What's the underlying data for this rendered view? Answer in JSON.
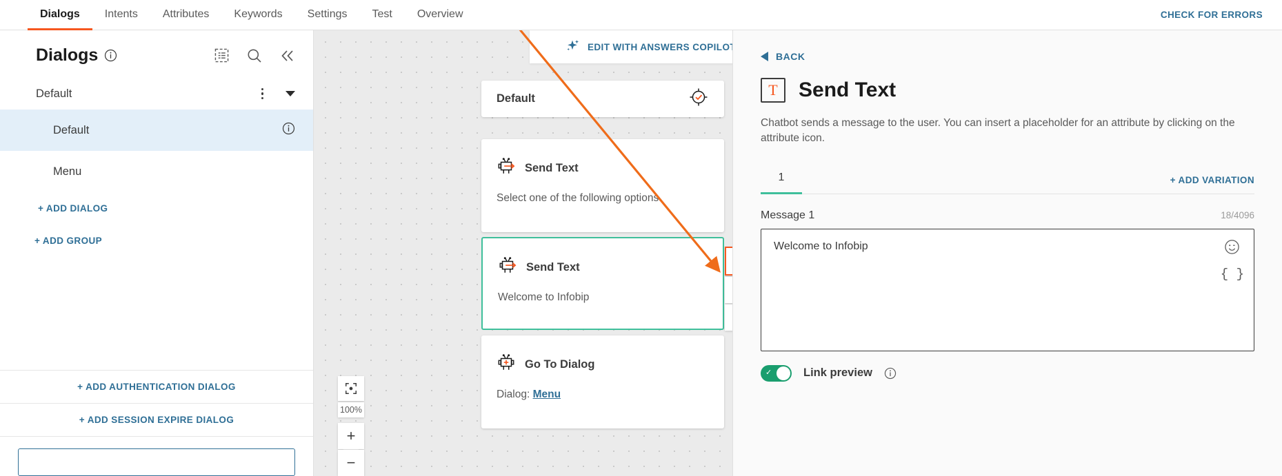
{
  "topbar": {
    "tabs": [
      {
        "label": "Dialogs",
        "active": true
      },
      {
        "label": "Intents",
        "active": false
      },
      {
        "label": "Attributes",
        "active": false
      },
      {
        "label": "Keywords",
        "active": false
      },
      {
        "label": "Settings",
        "active": false
      },
      {
        "label": "Test",
        "active": false
      },
      {
        "label": "Overview",
        "active": false
      }
    ],
    "check_errors_label": "CHECK FOR ERRORS"
  },
  "sidebar": {
    "title": "Dialogs",
    "icons": [
      "outline-list-icon",
      "search-icon",
      "collapse-panel-icon"
    ],
    "group": {
      "label": "Default"
    },
    "items": [
      {
        "label": "Default",
        "selected": true
      },
      {
        "label": "Menu",
        "selected": false
      }
    ],
    "add_dialog_label": "+ ADD DIALOG",
    "add_group_label": "+ ADD GROUP",
    "add_auth_dialog_label": "+ ADD AUTHENTICATION DIALOG",
    "add_session_expire_label": "+ ADD SESSION EXPIRE DIALOG"
  },
  "canvas": {
    "copilot_label": "EDIT WITH ANSWERS COPILOT",
    "zoom_level": "100%",
    "nodes": {
      "default": {
        "title": "Default"
      },
      "send_text_1": {
        "title": "Send Text",
        "body": "Select one of the following options."
      },
      "send_text_2": {
        "title": "Send Text",
        "body": "Welcome to Infobip"
      },
      "go_to_dialog": {
        "title": "Go To Dialog",
        "prefix": "Dialog: ",
        "link": "Menu"
      }
    },
    "tools": [
      "move-handle-icon",
      "delete-icon",
      "duplicate-icon"
    ]
  },
  "panel": {
    "back_label": "BACK",
    "icon_glyph": "T",
    "title": "Send Text",
    "description": "Chatbot sends a message to the user. You can insert a placeholder for an attribute by clicking on the attribute icon.",
    "variation_tab": "1",
    "add_variation_label": "+ ADD VARIATION",
    "message_label": "Message 1",
    "char_count": "18/4096",
    "message_value": "Welcome to Infobip",
    "braces_glyph": "{ }",
    "link_preview_label": "Link preview"
  },
  "colors": {
    "accent_orange": "#f6571f",
    "link_blue": "#2f6f96",
    "teal": "#3fbf9b",
    "toggle_green": "#1a9e6e",
    "selected_row": "#e3eff9"
  }
}
